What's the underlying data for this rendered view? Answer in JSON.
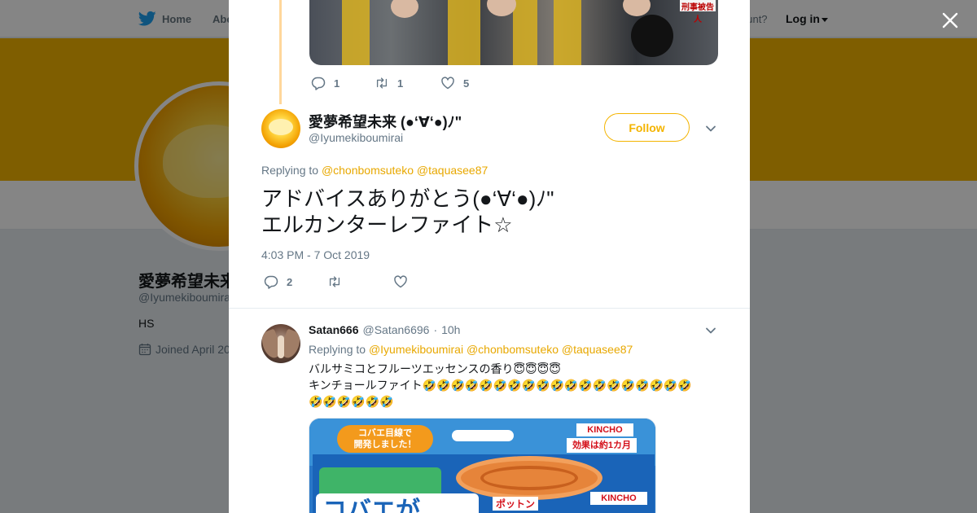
{
  "nav": {
    "home_label": "Home",
    "about_label": "Abo",
    "account_label": "ccount?",
    "login_label": "Log in"
  },
  "background_profile": {
    "name": "愛夢希望未来",
    "handle": "@Iyumekiboumirai",
    "bio": "HS",
    "joined": "Joined April 20"
  },
  "previous_tweet": {
    "media_sign_text": "刑事被告人",
    "reply_count": "1",
    "retweet_count": "1",
    "like_count": "5"
  },
  "main_tweet": {
    "author_name": "愛夢希望未来 (●‘∀‘●)ﾉ\"",
    "author_handle": "@Iyumekiboumirai",
    "follow_label": "Follow",
    "replying_prefix": "Replying to",
    "replying_mentions": [
      "@chonbomsuteko",
      "@taquasee87"
    ],
    "text_line1": "アドバイスありがとう(●‘∀‘●)ﾉ\"",
    "text_line2": "エルカンターレファイト☆",
    "timestamp": "4:03 PM - 7 Oct 2019",
    "reply_count": "2"
  },
  "reply_tweet": {
    "author_name": "Satan666",
    "author_handle": "@Satan6696",
    "separator": "·",
    "time": "10h",
    "replying_prefix": "Replying to",
    "replying_mentions": [
      "@Iyumekiboumirai",
      "@chonbomsuteko",
      "@taquasee87"
    ],
    "text": "バルサミコとフルーツエッセンスの香り😇😇😇😇\nキンチョールファイト🤣🤣🤣🤣🤣🤣🤣🤣🤣🤣🤣🤣🤣🤣🤣🤣🤣🤣🤣\n🤣🤣🤣🤣🤣🤣",
    "media": {
      "bubble_text": "コバエ目線で\n開発しました！",
      "brand": "KINCHO",
      "badge": "効果は約1カ月",
      "product_name": "コバエが",
      "sub_text": "ポットン"
    }
  },
  "colors": {
    "accent": "#f4b400",
    "mention": "#e8a800",
    "text_primary": "#14171a",
    "text_secondary": "#657786",
    "twitter_blue": "#1da1f2"
  },
  "icons": [
    "twitter-bird-icon",
    "close-icon",
    "reply-icon",
    "retweet-icon",
    "like-icon",
    "chevron-down-icon",
    "calendar-icon"
  ]
}
